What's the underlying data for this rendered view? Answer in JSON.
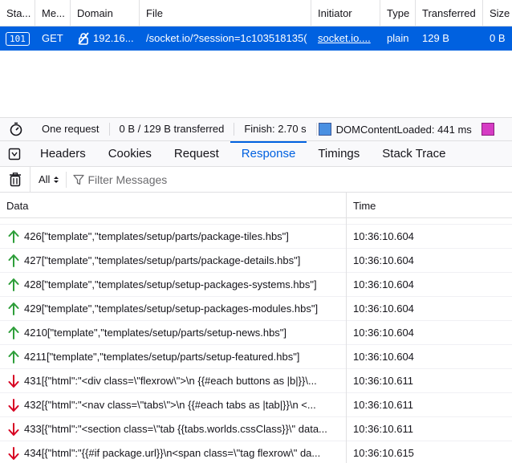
{
  "request_table": {
    "columns": [
      "Sta...",
      "Me...",
      "Domain",
      "File",
      "Initiator",
      "Type",
      "Transferred",
      "Size"
    ],
    "row": {
      "status": "101",
      "method": "GET",
      "domain": "192.16...",
      "file": "/socket.io/?session=1c103518135(",
      "initiator": "socket.io....",
      "type": "plain",
      "transferred": "129 B",
      "size": "0 B"
    }
  },
  "summary": {
    "requests": "One request",
    "transferred": "0 B / 129 B transferred",
    "finish": "Finish: 2.70 s",
    "dcl": "DOMContentLoaded: 441 ms",
    "dcl_color": "#4a90e2",
    "load_color": "#d63cc4"
  },
  "tabs": [
    "Headers",
    "Cookies",
    "Request",
    "Response",
    "Timings",
    "Stack Trace"
  ],
  "active_tab": "Response",
  "filter": {
    "type_select": "All",
    "placeholder": "Filter Messages"
  },
  "messages_table": {
    "columns": {
      "data": "Data",
      "time": "Time"
    },
    "rows": [
      {
        "dir": "sent",
        "data": "426[\"template\",\"templates/setup/parts/package-tiles.hbs\"]",
        "time": "10:36:10.604"
      },
      {
        "dir": "sent",
        "data": "427[\"template\",\"templates/setup/parts/package-details.hbs\"]",
        "time": "10:36:10.604"
      },
      {
        "dir": "sent",
        "data": "428[\"template\",\"templates/setup/setup-packages-systems.hbs\"]",
        "time": "10:36:10.604"
      },
      {
        "dir": "sent",
        "data": "429[\"template\",\"templates/setup/setup-packages-modules.hbs\"]",
        "time": "10:36:10.604"
      },
      {
        "dir": "sent",
        "data": "4210[\"template\",\"templates/setup/parts/setup-news.hbs\"]",
        "time": "10:36:10.604"
      },
      {
        "dir": "sent",
        "data": "4211[\"template\",\"templates/setup/parts/setup-featured.hbs\"]",
        "time": "10:36:10.604"
      },
      {
        "dir": "received",
        "data": "431[{\"html\":\"<div class=\\\"flexrow\\\">\\n {{#each buttons as |b|}}\\...",
        "time": "10:36:10.611"
      },
      {
        "dir": "received",
        "data": "432[{\"html\":\"<nav class=\\\"tabs\\\">\\n {{#each tabs as |tab|}}\\n <...",
        "time": "10:36:10.611"
      },
      {
        "dir": "received",
        "data": "433[{\"html\":\"<section class=\\\"tab {{tabs.worlds.cssClass}}\\\" data...",
        "time": "10:36:10.611"
      },
      {
        "dir": "received",
        "data": "434[{\"html\":\"{{#if package.url}}\\n<span class=\\\"tag flexrow\\\" da...",
        "time": "10:36:10.615"
      }
    ]
  },
  "colors": {
    "accent": "#0061e0",
    "sent_arrow": "#2e9e3a",
    "received_arrow": "#d70022"
  }
}
